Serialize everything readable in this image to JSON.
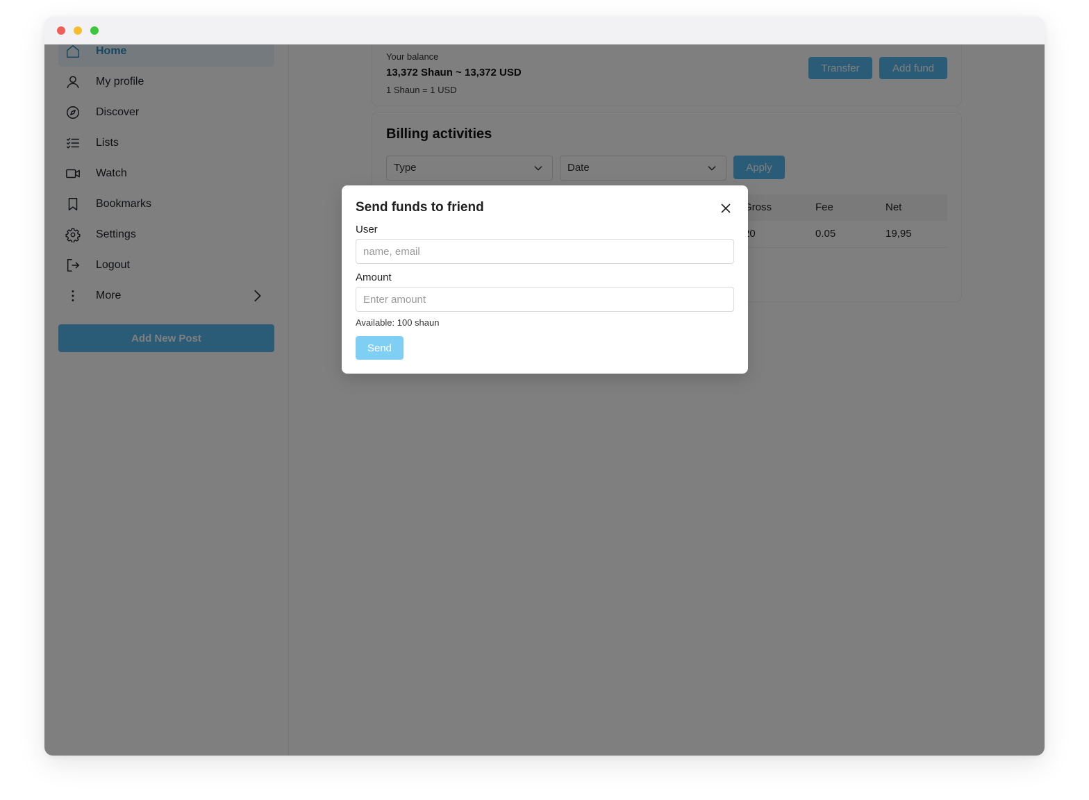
{
  "sidebar": {
    "items": [
      {
        "label": "Home",
        "icon": "home-icon",
        "active": true
      },
      {
        "label": "My profile",
        "icon": "user-icon"
      },
      {
        "label": "Discover",
        "icon": "compass-icon"
      },
      {
        "label": "Lists",
        "icon": "list-icon"
      },
      {
        "label": "Watch",
        "icon": "video-icon"
      },
      {
        "label": "Bookmarks",
        "icon": "bookmark-icon"
      },
      {
        "label": "Settings",
        "icon": "gear-icon"
      },
      {
        "label": "Logout",
        "icon": "logout-icon"
      },
      {
        "label": "More",
        "icon": "more-vertical-icon"
      }
    ],
    "add_post_label": "Add New Post"
  },
  "balance": {
    "heading": "Your balance",
    "amount": "13,372 Shaun ~ 13,372 USD",
    "rate": "1 Shaun = 1 USD",
    "transfer_label": "Transfer",
    "add_fund_label": "Add fund"
  },
  "billing": {
    "title": "Billing activities",
    "type_select": "Type",
    "date_select": "Date",
    "apply_label": "Apply",
    "columns": [
      "Gross",
      "Fee",
      "Net"
    ],
    "rows": [
      {
        "gross": "20",
        "fee": "0.05",
        "net": "19,95"
      }
    ]
  },
  "modal": {
    "title": "Send funds to friend",
    "user_label": "User",
    "user_placeholder": "name, email",
    "amount_label": "Amount",
    "amount_placeholder": "Enter amount",
    "available": "Available: 100 shaun",
    "send_label": "Send"
  },
  "colors": {
    "accent": "#54b8ef",
    "send_button": "#7fcff5",
    "active_nav": "#2e8fc0"
  }
}
